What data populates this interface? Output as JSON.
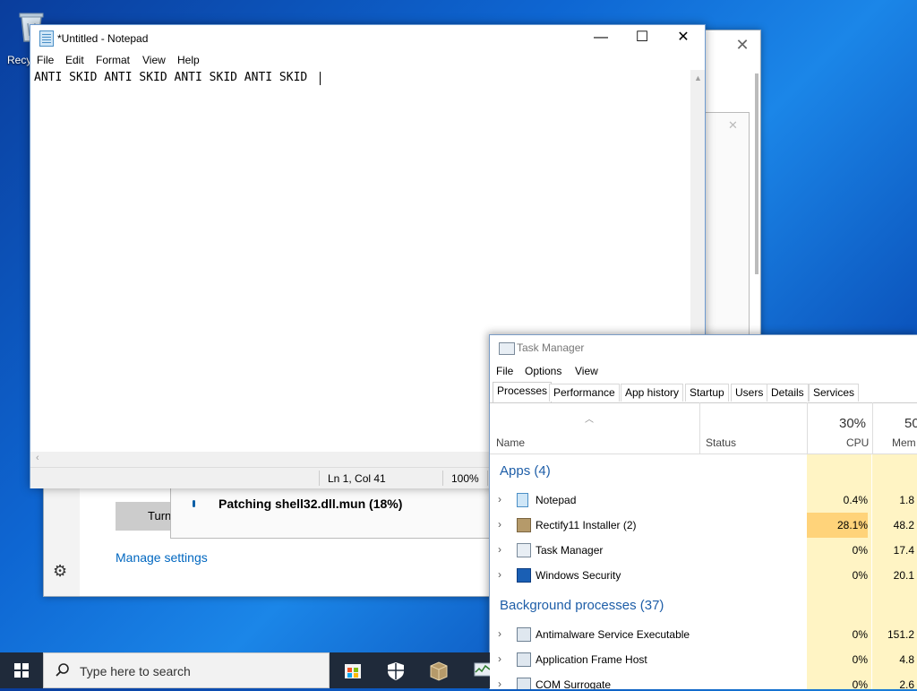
{
  "desktop": {
    "recycle_label": "Recy"
  },
  "security_window": {
    "turn_label": "Turn on",
    "manage_link": "Manage settings",
    "close_glyph": "✕",
    "gear_glyph": "⚙"
  },
  "installer": {
    "status": "Patching shell32.dll.mun (18%)",
    "close_glyph": "✕"
  },
  "notepad": {
    "title": "*Untitled - Notepad",
    "menu": [
      "File",
      "Edit",
      "Format",
      "View",
      "Help"
    ],
    "content": "ANTI SKID ANTI SKID ANTI SKID ANTI SKID ",
    "status_position": "Ln 1, Col 41",
    "status_zoom": "100%",
    "minimize_glyph": "—",
    "maximize_glyph": "☐",
    "close_glyph": "✕"
  },
  "task_manager": {
    "title": "Task Manager",
    "menu": [
      "File",
      "Options",
      "View"
    ],
    "tabs": [
      "Processes",
      "Performance",
      "App history",
      "Startup",
      "Users",
      "Details",
      "Services"
    ],
    "active_tab": "Processes",
    "columns": {
      "name": "Name",
      "status": "Status",
      "cpu": "CPU",
      "memory": "Mem"
    },
    "cpu_total": "30%",
    "memory_total": "50",
    "apps_group": "Apps (4)",
    "background_group": "Background processes (37)",
    "apps": [
      {
        "name": "Notepad",
        "cpu": "0.4%",
        "mem": "1.8"
      },
      {
        "name": "Rectify11 Installer (2)",
        "cpu": "28.1%",
        "mem": "48.2"
      },
      {
        "name": "Task Manager",
        "cpu": "0%",
        "mem": "17.4"
      },
      {
        "name": "Windows Security",
        "cpu": "0%",
        "mem": "20.1"
      }
    ],
    "background": [
      {
        "name": "Antimalware Service Executable",
        "cpu": "0%",
        "mem": "151.2"
      },
      {
        "name": "Application Frame Host",
        "cpu": "0%",
        "mem": "4.8"
      },
      {
        "name": "COM Surrogate",
        "cpu": "0%",
        "mem": "2.6"
      }
    ]
  },
  "taskbar": {
    "search_placeholder": "Type here to search"
  },
  "colors": {
    "accent": "#0067c0",
    "cpu_highlight": "#ffd37a",
    "cpu_column": "#fff4c4"
  }
}
